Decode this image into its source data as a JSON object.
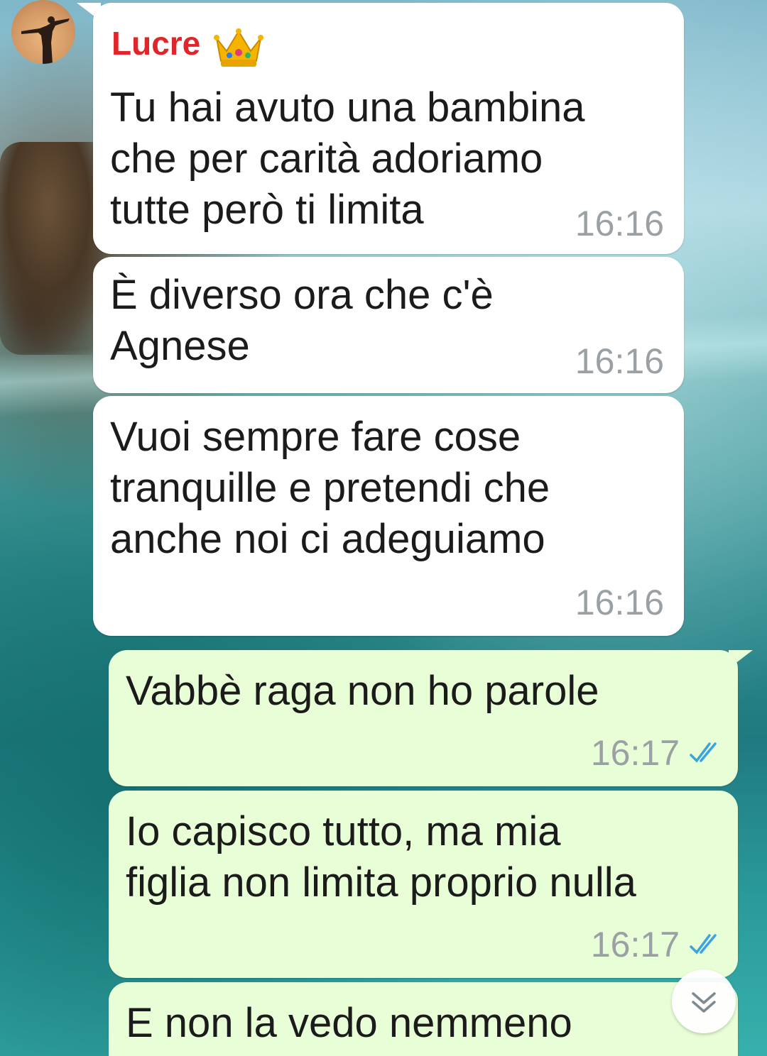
{
  "sender": {
    "name": "Lucre",
    "badge_icon": "crown-emoji"
  },
  "messages": [
    {
      "direction": "incoming",
      "text": "Tu hai avuto una bambina\nche per carità adoriamo\ntutte però ti limita",
      "time": "16:16"
    },
    {
      "direction": "incoming",
      "text": "È diverso ora che c'è\nAgnese",
      "time": "16:16"
    },
    {
      "direction": "incoming",
      "text": "Vuoi sempre fare cose\ntranquille e pretendi che\nanche noi ci adeguiamo",
      "time": "16:16"
    },
    {
      "direction": "outgoing",
      "text": "Vabbè raga non ho parole",
      "time": "16:17",
      "status": "read"
    },
    {
      "direction": "outgoing",
      "text": "Io capisco tutto, ma mia\nfiglia non limita proprio nulla",
      "time": "16:17",
      "status": "read"
    },
    {
      "direction": "outgoing",
      "text": "E non la vedo nemmeno",
      "time": "",
      "status": ""
    }
  ],
  "colors": {
    "incoming_bubble": "#ffffff",
    "outgoing_bubble": "#e7fed6",
    "sender_name": "#e0262a",
    "read_ticks": "#3aa3e3",
    "timestamp": "#9aa0a3"
  },
  "scroll_button_icon": "double-chevron-down-icon"
}
